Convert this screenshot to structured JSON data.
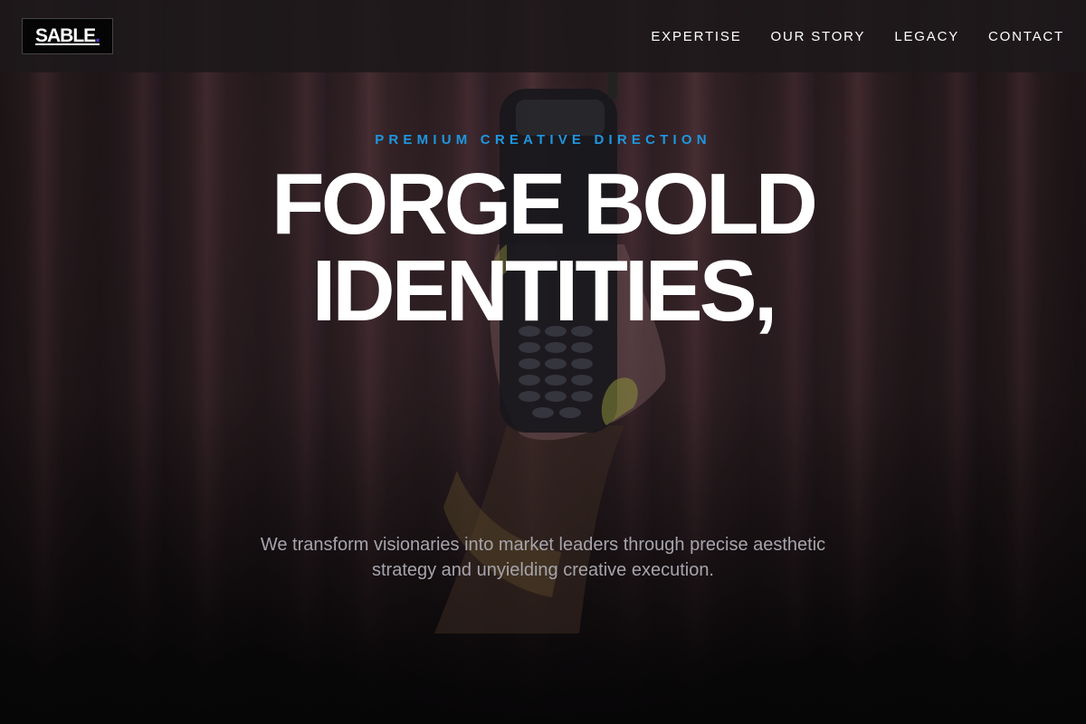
{
  "header": {
    "logo_text": "SABLE",
    "logo_dot": ".",
    "nav": [
      {
        "label": "EXPERTISE"
      },
      {
        "label": "OUR STORY"
      },
      {
        "label": "LEGACY"
      },
      {
        "label": "CONTACT"
      }
    ]
  },
  "hero": {
    "eyebrow": "PREMIUM CREATIVE DIRECTION",
    "headline_line1": "FORGE BOLD",
    "headline_line2": "IDENTITIES,",
    "subcopy": "We transform visionaries into market leaders through precise aesthetic strategy and unyielding creative execution."
  },
  "colors": {
    "accent": "#1e97e0",
    "logo_dot": "#5b34c9",
    "background": "#0b0a0b"
  }
}
